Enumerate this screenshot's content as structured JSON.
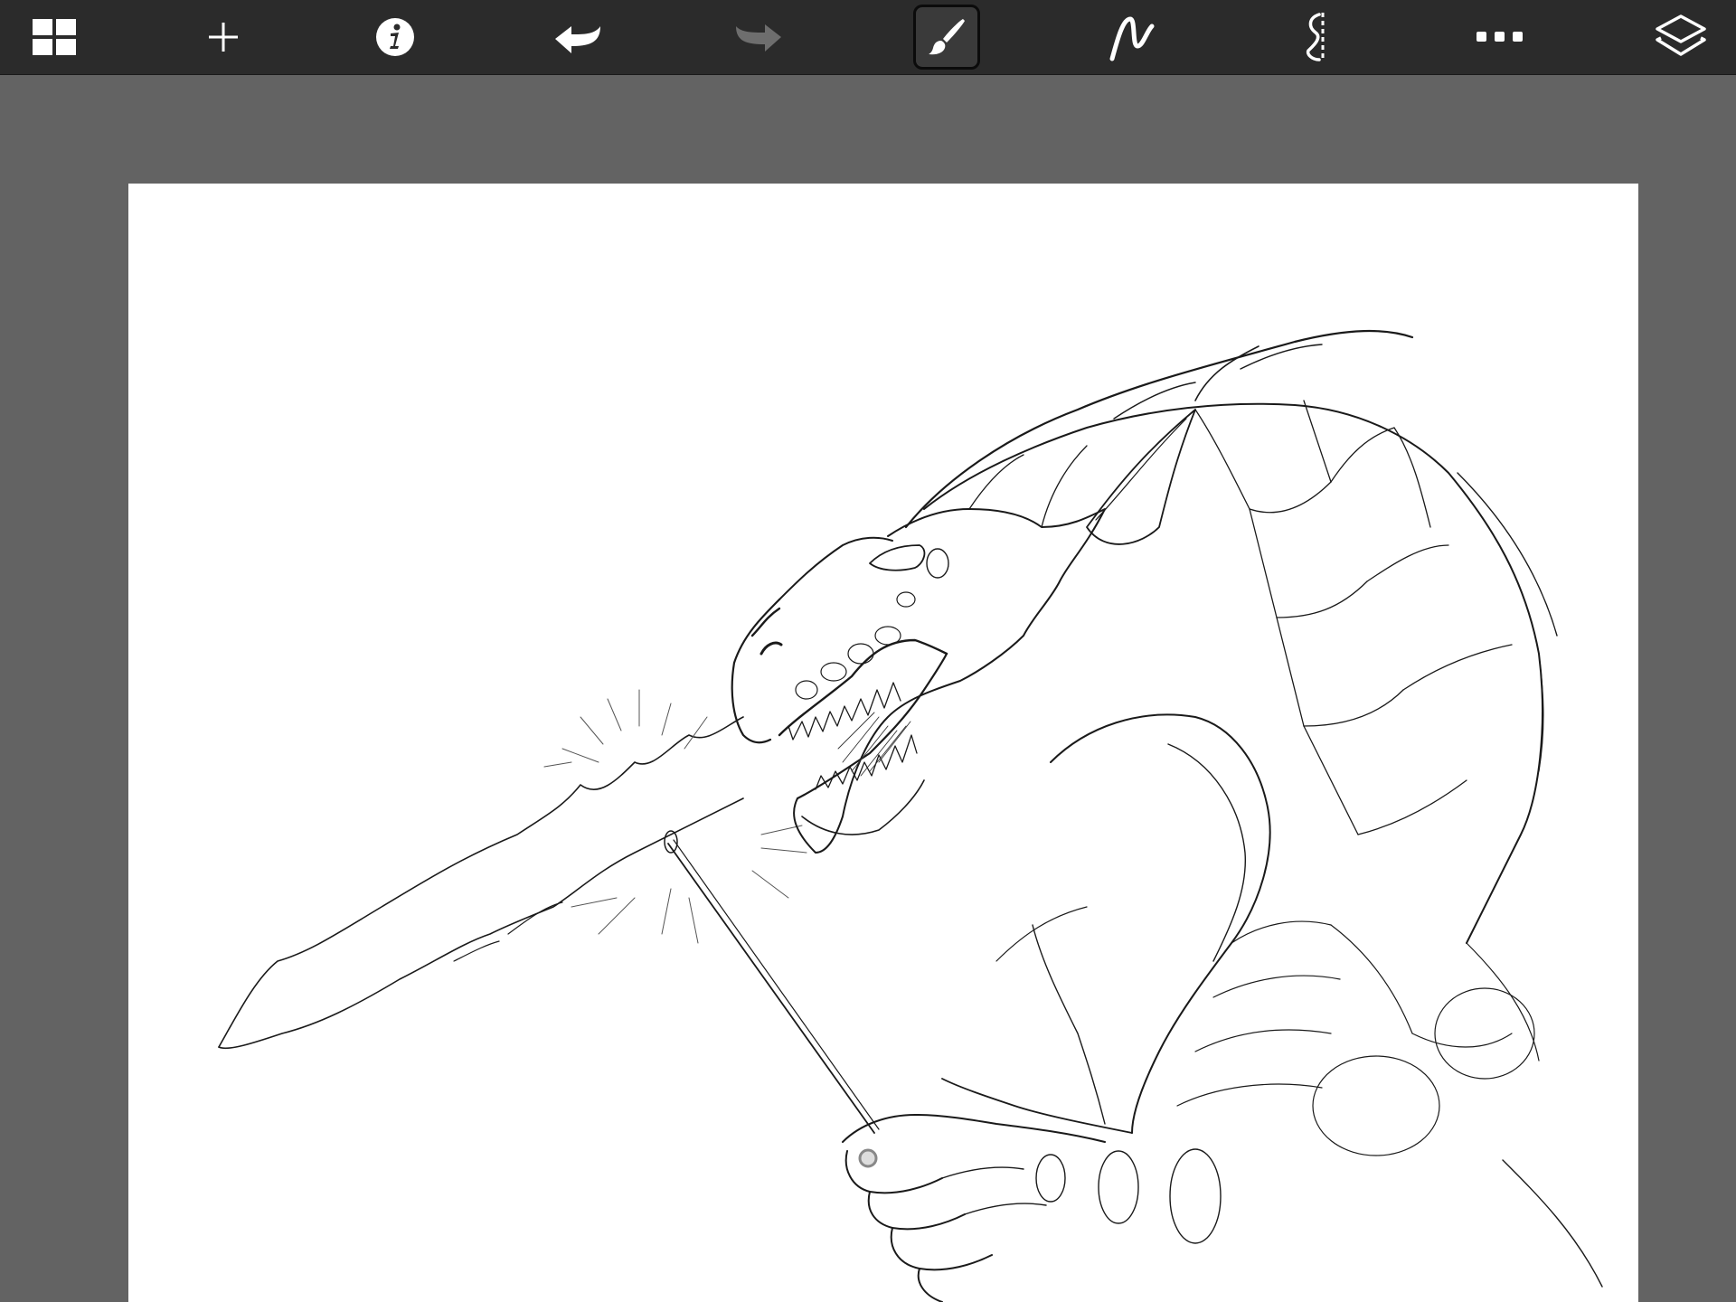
{
  "app": {
    "toolbar": {
      "tools": [
        {
          "id": "gallery",
          "icon": "gallery-grid-icon"
        },
        {
          "id": "new",
          "icon": "plus-icon"
        },
        {
          "id": "info",
          "icon": "info-icon"
        },
        {
          "id": "undo",
          "icon": "undo-arrow-icon"
        },
        {
          "id": "redo",
          "icon": "redo-arrow-icon",
          "disabled": true
        },
        {
          "id": "brush",
          "icon": "brush-icon",
          "active": true
        },
        {
          "id": "stroke",
          "icon": "stroke-curve-icon"
        },
        {
          "id": "symmetry",
          "icon": "symmetry-icon"
        },
        {
          "id": "more",
          "icon": "more-dots-icon"
        },
        {
          "id": "layers",
          "icon": "layers-icon"
        }
      ]
    },
    "colors": {
      "toolbar_bg": "#2b2b2b",
      "workspace_bg": "#636363",
      "canvas_bg": "#ffffff",
      "icon": "#ffffff",
      "icon_disabled": "#6e6e6e",
      "ink": "#1a1a1a"
    }
  }
}
